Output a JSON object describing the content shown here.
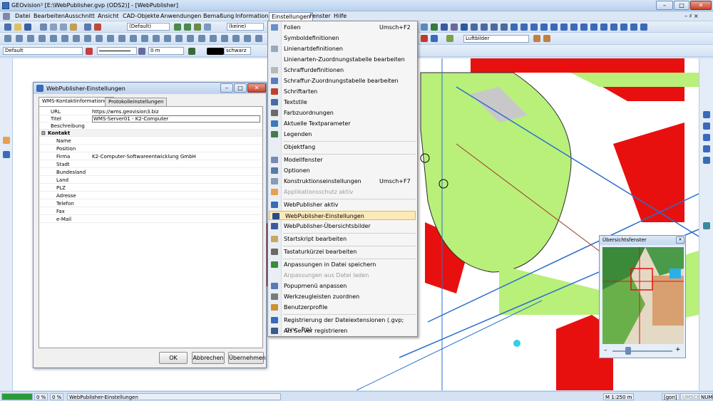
{
  "window": {
    "title": "GEOvision³  [E:\\WebPublisher.gvp (ODS2)] - [WebPublisher]",
    "minimize": "–",
    "maximize": "□",
    "close": "✕"
  },
  "menubar": {
    "items": [
      "Datei",
      "Bearbeiten",
      "Ausschnitt",
      "Ansicht",
      "CAD-Objekte",
      "Anwendungen",
      "Bemaßung",
      "Information",
      "Einstellungen",
      "Fenster",
      "Hilfe"
    ],
    "active": "Einstellungen",
    "mdi_controls": "– ♯ ×"
  },
  "toolbar": {
    "style_combo": "(Default)",
    "layer_combo": "(keine)",
    "aerial_combo": "Luftbilder",
    "default_combo": "Default",
    "size_combo": "0 m",
    "color_combo": "schwarz"
  },
  "settings_menu": {
    "items": [
      {
        "label": "Folien",
        "shortcut": "Umsch+F2",
        "icon_color": "#6a8fc4",
        "disabled": false
      },
      {
        "label": "Symboldefinitionen",
        "shortcut": "",
        "icon_color": "",
        "disabled": false
      },
      {
        "label": "Linienartdefinitionen",
        "shortcut": "",
        "icon_color": "#9aa8bc",
        "disabled": false
      },
      {
        "label": "Linienarten-Zuordnungstabelle bearbeiten",
        "shortcut": "",
        "icon_color": "",
        "disabled": false
      },
      {
        "label": "Schraffurdefinitionen",
        "shortcut": "",
        "icon_color": "#b8b8b8",
        "disabled": false
      },
      {
        "label": "Schraffur-Zuordnungstabelle bearbeiten",
        "shortcut": "",
        "icon_color": "#5a7fb8",
        "disabled": false
      },
      {
        "label": "Schriftarten",
        "shortcut": "",
        "icon_color": "#c0402a",
        "disabled": false
      },
      {
        "label": "Textstile",
        "shortcut": "",
        "icon_color": "#4a6aa8",
        "disabled": false
      },
      {
        "label": "Farbzuordnungen",
        "shortcut": "",
        "icon_color": "#6a6a6a",
        "disabled": false
      },
      {
        "label": "Aktuelle Textparameter",
        "shortcut": "",
        "icon_color": "#3a7ab8",
        "disabled": false
      },
      {
        "label": "Legenden",
        "shortcut": "",
        "icon_color": "#4a7a4a",
        "disabled": false
      },
      {
        "label": "Objektfang",
        "shortcut": "",
        "icon_color": "",
        "disabled": false
      },
      {
        "label": "Modellfenster",
        "shortcut": "",
        "icon_color": "#7a8ab8",
        "disabled": false
      },
      {
        "label": "Optionen",
        "shortcut": "",
        "icon_color": "#5a7aa8",
        "disabled": false
      },
      {
        "label": "Konstruktionseinstellungen",
        "shortcut": "Umsch+F7",
        "icon_color": "#8a9ab8",
        "disabled": false
      },
      {
        "label": "Applikationsschutz aktiv",
        "shortcut": "",
        "icon_color": "#e8a050",
        "disabled": true
      },
      {
        "label": "WebPublisher aktiv",
        "shortcut": "",
        "icon_color": "#3a6ab8",
        "disabled": false
      },
      {
        "label": "WebPublisher-Einstellungen",
        "shortcut": "",
        "icon_color": "#2a4a8a",
        "disabled": false
      },
      {
        "label": "WebPublisher-Übersichtsbilder",
        "shortcut": "",
        "icon_color": "#3a5a9a",
        "disabled": false
      },
      {
        "label": "Startskript bearbeiten",
        "shortcut": "",
        "icon_color": "#c8a860",
        "disabled": false
      },
      {
        "label": "Tastaturkürzel bearbeiten",
        "shortcut": "",
        "icon_color": "#6a6a6a",
        "disabled": false
      },
      {
        "label": "Anpassungen in Datei speichern",
        "shortcut": "",
        "icon_color": "#3a8a3a",
        "disabled": false
      },
      {
        "label": "Anpassungen aus Datei laden",
        "shortcut": "",
        "icon_color": "",
        "disabled": true
      },
      {
        "label": "Popupmenü anpassen",
        "shortcut": "",
        "icon_color": "#5a7ab8",
        "disabled": false
      },
      {
        "label": "Werkzeugleisten zuordnen",
        "shortcut": "",
        "icon_color": "#7a7a7a",
        "disabled": false
      },
      {
        "label": "Benutzerprofile",
        "shortcut": "",
        "icon_color": "#d09030",
        "disabled": false
      },
      {
        "label": "Registrierung der Dateiextensionen (.gvp; .gvv; .frp)",
        "shortcut": "",
        "icon_color": "#3a6ab8",
        "disabled": false
      },
      {
        "label": "Als Server registrieren",
        "shortcut": "",
        "icon_color": "#3a5a8a",
        "disabled": false
      }
    ],
    "highlighted": "WebPublisher-Einstellungen"
  },
  "dialog": {
    "title": "WebPublisher-Einstellungen",
    "tabs": [
      "WMS-Kontaktinformationen",
      "Protokolleinstellungen"
    ],
    "selected_tab": "WMS-Kontaktinformationen",
    "rows": [
      {
        "key": "URL",
        "value": "https://wms.geovision3.biz"
      },
      {
        "key": "Titel",
        "value": "WMS-Server01 - K2-Computer"
      },
      {
        "key": "Beschreibung",
        "value": ""
      }
    ],
    "category": "Kontakt",
    "contact_rows": [
      {
        "key": "Name",
        "value": ""
      },
      {
        "key": "Position",
        "value": ""
      },
      {
        "key": "Firma",
        "value": "K2-Computer-Softwareentwicklung GmbH"
      },
      {
        "key": "Stadt",
        "value": ""
      },
      {
        "key": "Bundesland",
        "value": ""
      },
      {
        "key": "Land",
        "value": ""
      },
      {
        "key": "PLZ",
        "value": ""
      },
      {
        "key": "Adresse",
        "value": ""
      },
      {
        "key": "Telefon",
        "value": ""
      },
      {
        "key": "Fax",
        "value": ""
      },
      {
        "key": "e-Mail",
        "value": ""
      }
    ],
    "buttons": {
      "ok": "OK",
      "cancel": "Abbrechen",
      "apply": "Übernehmen"
    }
  },
  "overview": {
    "title": "Übersichtsfenster",
    "zoom_minus": "–",
    "zoom_plus": "+"
  },
  "statusbar": {
    "pct1": "0 %",
    "pct2": "0 %",
    "message": "WebPublisher-Einstellungen",
    "scale": "M 1:250  m",
    "unit": "[gon]",
    "caps": "UMSCH",
    "num": "NUM"
  },
  "colors": {
    "red_area": "#e8100e",
    "green_area": "#b8f07a",
    "pipe_blue": "#2c6fd0",
    "highlight": "#fbe9b7"
  }
}
